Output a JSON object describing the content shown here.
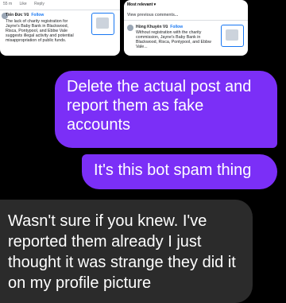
{
  "attachments": {
    "left": {
      "meta": {
        "age": "55 m",
        "like": "Like",
        "reply": "Reply"
      },
      "author": "Tiến Đức Vũ",
      "follow": "Follow",
      "comment": "The lack of charity registration for Jayne's Baby Bank in Blackwood, Risca, Pontypool, and Ebbw Vale suggests illegal activity and potential misappropriation of public funds."
    },
    "right": {
      "sort": "Most relevant",
      "previous": "View previous comments...",
      "author": "Hồng Khuyên Vũ",
      "follow": "Follow",
      "comment": "Without registration with the charity commission, Jayne's Baby Bank in Blackwood, Risca, Pontypool, and Ebbw Vale..."
    }
  },
  "messages": {
    "sent_1": "Delete the actual post and report them as fake accounts",
    "sent_2": "It's this bot spam thing",
    "received_1": "Wasn't sure if you knew. I've reported them already I just thought it was strange they did it on my profile picture"
  },
  "colors": {
    "sent_bubble": "#7b2ff7",
    "received_bubble": "#2b2b2b",
    "background": "#000000",
    "link": "#1877f2"
  }
}
